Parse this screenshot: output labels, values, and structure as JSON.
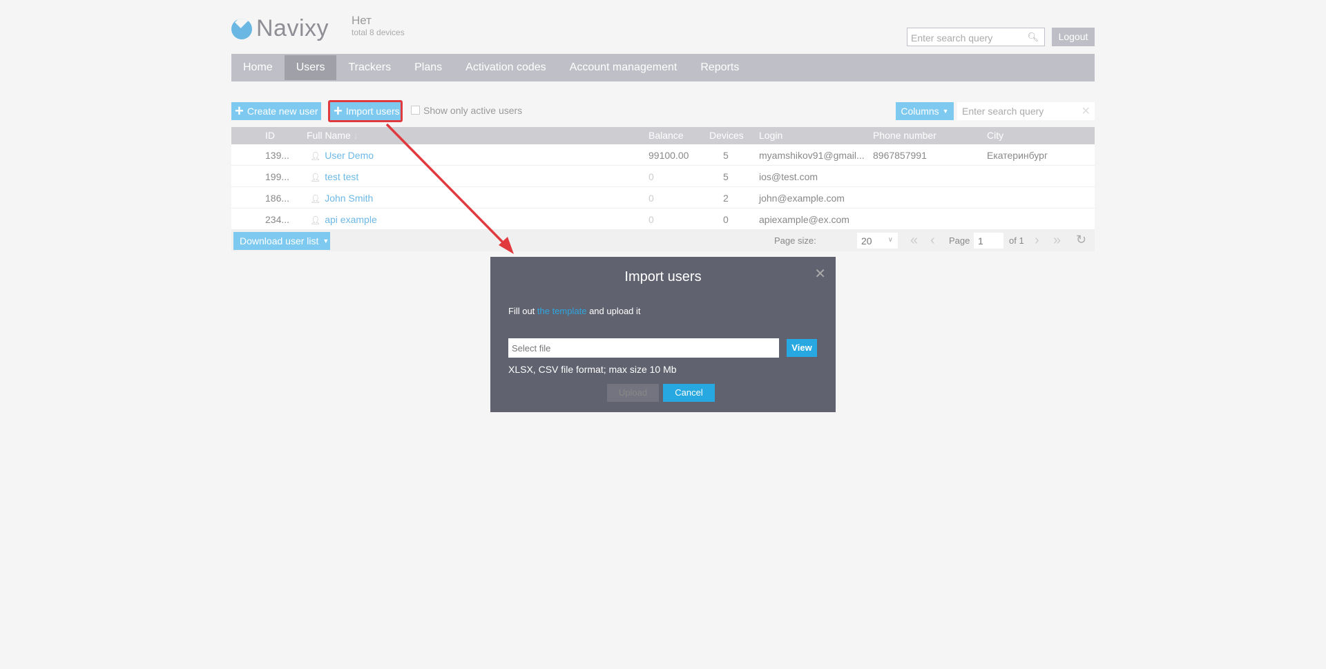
{
  "header": {
    "logo_text": "Navixy",
    "account_name": "Нет",
    "account_sub": "total 8 devices",
    "search_placeholder": "Enter search query",
    "logout_label": "Logout"
  },
  "nav": {
    "items": [
      {
        "label": "Home"
      },
      {
        "label": "Users",
        "active": true
      },
      {
        "label": "Trackers"
      },
      {
        "label": "Plans"
      },
      {
        "label": "Activation codes"
      },
      {
        "label": "Account management"
      },
      {
        "label": "Reports"
      }
    ]
  },
  "toolbar": {
    "create_label": "Create new user",
    "import_label": "Import users",
    "active_only_label": "Show only active users",
    "active_only_checked": false,
    "columns_label": "Columns",
    "search_placeholder": "Enter search query"
  },
  "table": {
    "columns": [
      "ID",
      "Full Name",
      "Balance",
      "Devices",
      "Login",
      "Phone number",
      "City"
    ],
    "sort_indicator": "↓",
    "rows": [
      {
        "id": "139...",
        "name": "User Demo",
        "balance": "99100.00",
        "devices": "5",
        "login": "myamshikov91@gmail...",
        "phone": "8967857991",
        "city": "Екатеринбург"
      },
      {
        "id": "199...",
        "name": "test test",
        "balance": "0",
        "devices": "5",
        "login": "ios@test.com",
        "phone": "",
        "city": ""
      },
      {
        "id": "186...",
        "name": "John Smith",
        "balance": "0",
        "devices": "2",
        "login": "john@example.com",
        "phone": "",
        "city": ""
      },
      {
        "id": "234...",
        "name": "api example",
        "balance": "0",
        "devices": "0",
        "login": "apiexample@ex.com",
        "phone": "",
        "city": ""
      }
    ]
  },
  "footer": {
    "download_label": "Download user list",
    "page_size_label": "Page size:",
    "page_size": "20",
    "page_label": "Page",
    "page": "1",
    "of_label": "of 1"
  },
  "modal": {
    "title": "Import users",
    "desc_prefix": "Fill out ",
    "desc_link": "the template",
    "desc_suffix": " and upload it",
    "file_placeholder": "Select file",
    "view_label": "View",
    "format_note": "XLSX, CSV file format; max size 10 Mb",
    "upload_label": "Upload",
    "cancel_label": "Cancel"
  },
  "colors": {
    "accent": "#28a8e0",
    "light_button": "#7dc9ef",
    "nav_bg": "#bfbfc7",
    "modal_bg": "#61626f",
    "annotation": "#e0393e"
  }
}
